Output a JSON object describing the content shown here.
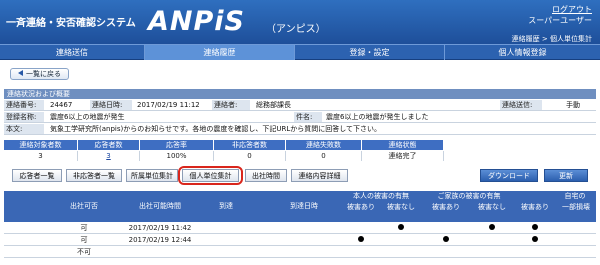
{
  "header": {
    "brand": "一斉連絡・安否確認システム",
    "logo": "ANPiS",
    "logo_sub": "（アンピス）",
    "logout": "ログアウト",
    "user": "スーパーユーザー",
    "breadcrumb": "連絡履歴 > 個人単位集計"
  },
  "nav": [
    "連絡送信",
    "連絡履歴",
    "登録・設定",
    "個人情報登録"
  ],
  "back_button": "一覧に戻る",
  "summary": {
    "title": "連絡状況および概要",
    "no_label": "連絡番号:",
    "no": "24467",
    "date_label": "連絡日時:",
    "date": "2017/02/19 11:12",
    "sender_label": "連絡者:",
    "sender": "総務部課長",
    "method_label": "連絡送信:",
    "method": "手動",
    "name_label": "登録名称:",
    "name": "震度6以上の地震が発生",
    "subject_label": "件名:",
    "subject": "震度6以上の地震が発生しました",
    "body_label": "本文:",
    "body": "気象工学研究所(anpis)からのお知らせです。各地の震度を確認し、下記URLから質問に回答して下さい。"
  },
  "stats": {
    "headers": [
      "連絡対象者数",
      "応答者数",
      "応答率",
      "非応答者数",
      "連絡失敗数",
      "連絡状態"
    ],
    "values": [
      "3",
      "3",
      "100%",
      "0",
      "0",
      "連絡完了"
    ]
  },
  "buttons": [
    "応答者一覧",
    "非応答者一覧",
    "所属単位集計",
    "個人単位集計",
    "出社時間",
    "連絡内容詳細"
  ],
  "download": "ダウンロード",
  "update": "更新",
  "table": {
    "h_yesno": "出社可否",
    "h_time": "出社可能時間",
    "h_arrive": "到達",
    "h_arrive_time": "到達日時",
    "h_self": "本人の被害の有無",
    "h_family": "ご家族の被害の有無",
    "h_house": "自宅の",
    "h_dmg": "被害あり",
    "h_nodmg": "被害なし",
    "h_part": "一部損壊",
    "rows": [
      {
        "yesno": "可",
        "time": "2017/02/19 11:42",
        "dots": [
          0,
          1,
          0,
          1,
          1
        ]
      },
      {
        "yesno": "可",
        "time": "2017/02/19 12:44",
        "dots": [
          1,
          0,
          1,
          0,
          1
        ]
      },
      {
        "yesno": "不可",
        "time": "",
        "dots": [
          0,
          0,
          0,
          0,
          0
        ]
      }
    ]
  }
}
